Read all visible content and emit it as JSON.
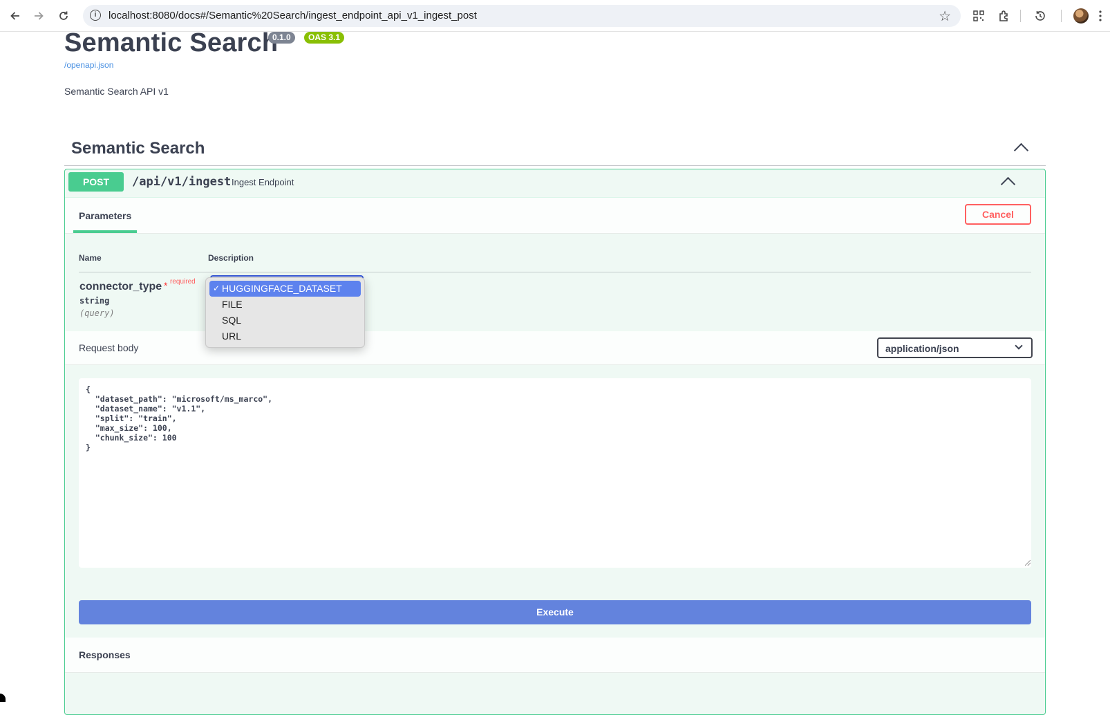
{
  "browser": {
    "url": "localhost:8080/docs#/Semantic%20Search/ingest_endpoint_api_v1_ingest_post",
    "icons": [
      "back-icon",
      "forward-icon",
      "reload-icon",
      "site-info-icon",
      "bookmark-star-icon",
      "qr-code-icon",
      "extensions-icon",
      "history-icon",
      "profile-avatar",
      "kebab-menu-icon"
    ]
  },
  "info": {
    "title": "Semantic Search",
    "version": "0.1.0",
    "oas": "OAS 3.1",
    "spec_link": "/openapi.json",
    "description": "Semantic Search API v1"
  },
  "tag": {
    "title": "Semantic Search"
  },
  "operation": {
    "method": "POST",
    "path": "/api/v1/ingest",
    "summary": "Ingest Endpoint",
    "tab_label": "Parameters",
    "cancel_label": "Cancel",
    "columns": {
      "name": "Name",
      "description": "Description"
    },
    "param": {
      "name": "connector_type",
      "star": "*",
      "required": "required",
      "type": "string",
      "in": "(query)"
    },
    "dropdown": {
      "check": "✓",
      "options": [
        "HUGGINGFACE_DATASET",
        "FILE",
        "SQL",
        "URL"
      ],
      "selected": "HUGGINGFACE_DATASET"
    },
    "request_body": {
      "title": "Request body",
      "content_type": "application/json",
      "body": "{\n  \"dataset_path\": \"microsoft/ms_marco\",\n  \"dataset_name\": \"v1.1\",\n  \"split\": \"train\",\n  \"max_size\": 100,\n  \"chunk_size\": 100\n}"
    },
    "execute_label": "Execute",
    "responses_title": "Responses"
  },
  "colors": {
    "post_green": "#49cc90",
    "execute_blue": "#6383dd",
    "cancel_red": "#ff6060",
    "dropdown_highlight": "#5d82ee"
  }
}
